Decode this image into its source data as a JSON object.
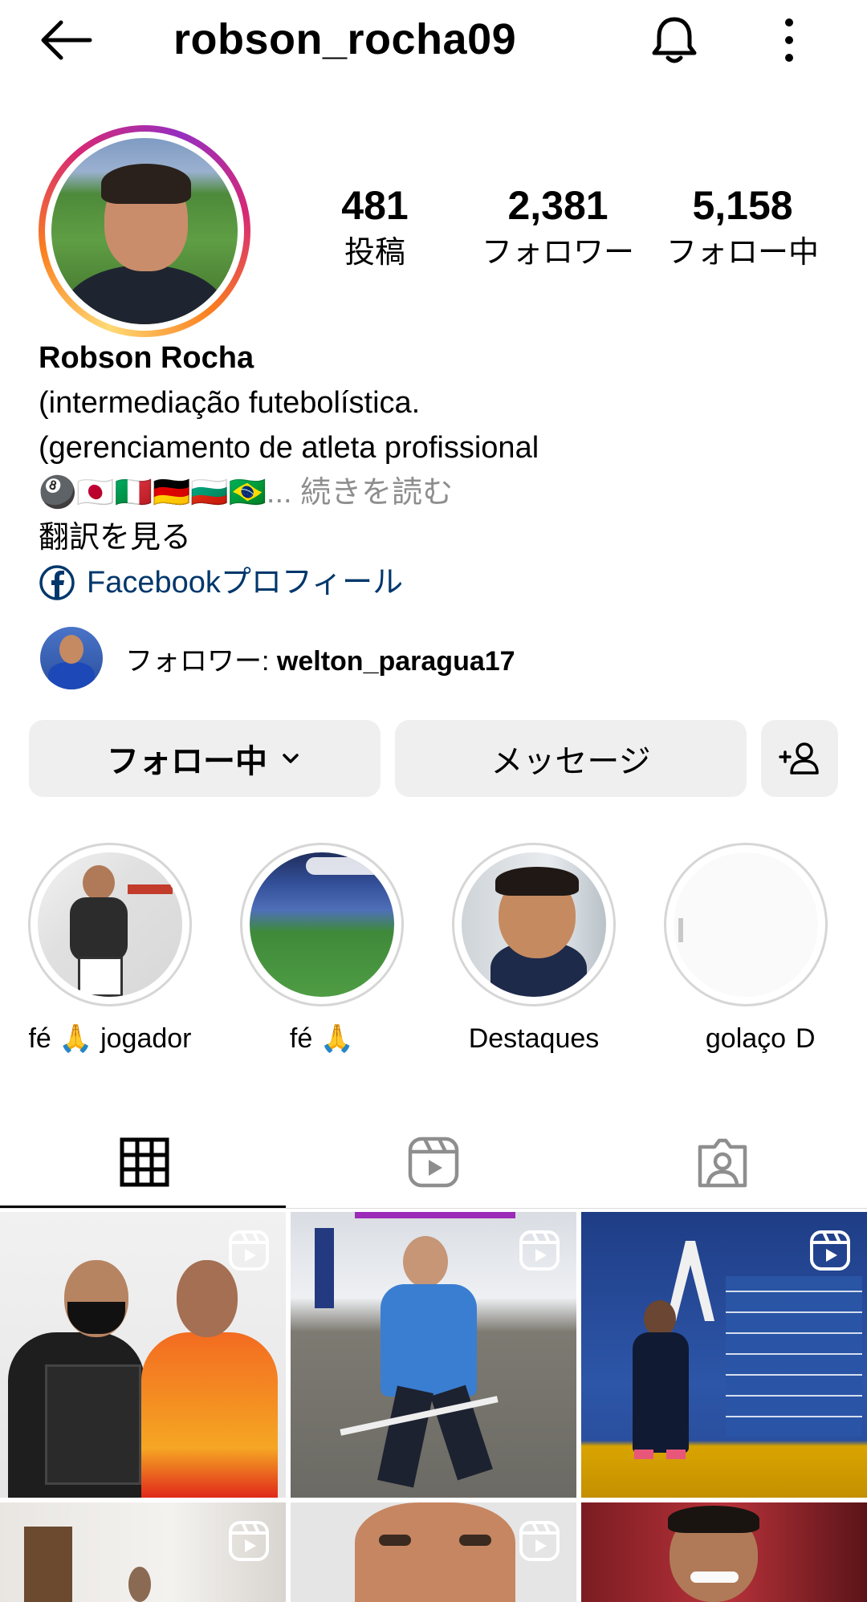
{
  "header": {
    "username": "robson_rocha09",
    "back_icon": "arrow-left-icon",
    "notify_icon": "bell-icon",
    "menu_icon": "more-vertical-icon"
  },
  "stats": [
    {
      "value": "481",
      "label": "投稿"
    },
    {
      "value": "2,381",
      "label": "フォロワー"
    },
    {
      "value": "5,158",
      "label": "フォロー中"
    }
  ],
  "bio": {
    "name": "Robson Rocha",
    "line1": "(intermediação futebolística.",
    "line2": "(gerenciamento de atleta profissional",
    "emojis": "🎱🇯🇵🇮🇹🇩🇪🇧🇬🇧🇷",
    "more": "... 続きを読む",
    "translate": "翻訳を見る",
    "facebook": "Facebookプロフィール"
  },
  "followed_by": {
    "prefix": "フォロワー: ",
    "user": "welton_paragua17"
  },
  "buttons": {
    "following": "フォロー中",
    "message": "メッセージ"
  },
  "highlights": [
    {
      "label": "fé 🙏 jogador"
    },
    {
      "label": "fé 🙏"
    },
    {
      "label": "Destaques"
    },
    {
      "label": "golaço"
    },
    {
      "label": "D"
    }
  ],
  "tabs": [
    {
      "icon": "grid-icon",
      "active": true
    },
    {
      "icon": "reels-icon",
      "active": false
    },
    {
      "icon": "tagged-icon",
      "active": false
    }
  ],
  "colors": {
    "link": "#00376b",
    "button_bg": "#efefef",
    "muted": "#8e8e8e"
  }
}
